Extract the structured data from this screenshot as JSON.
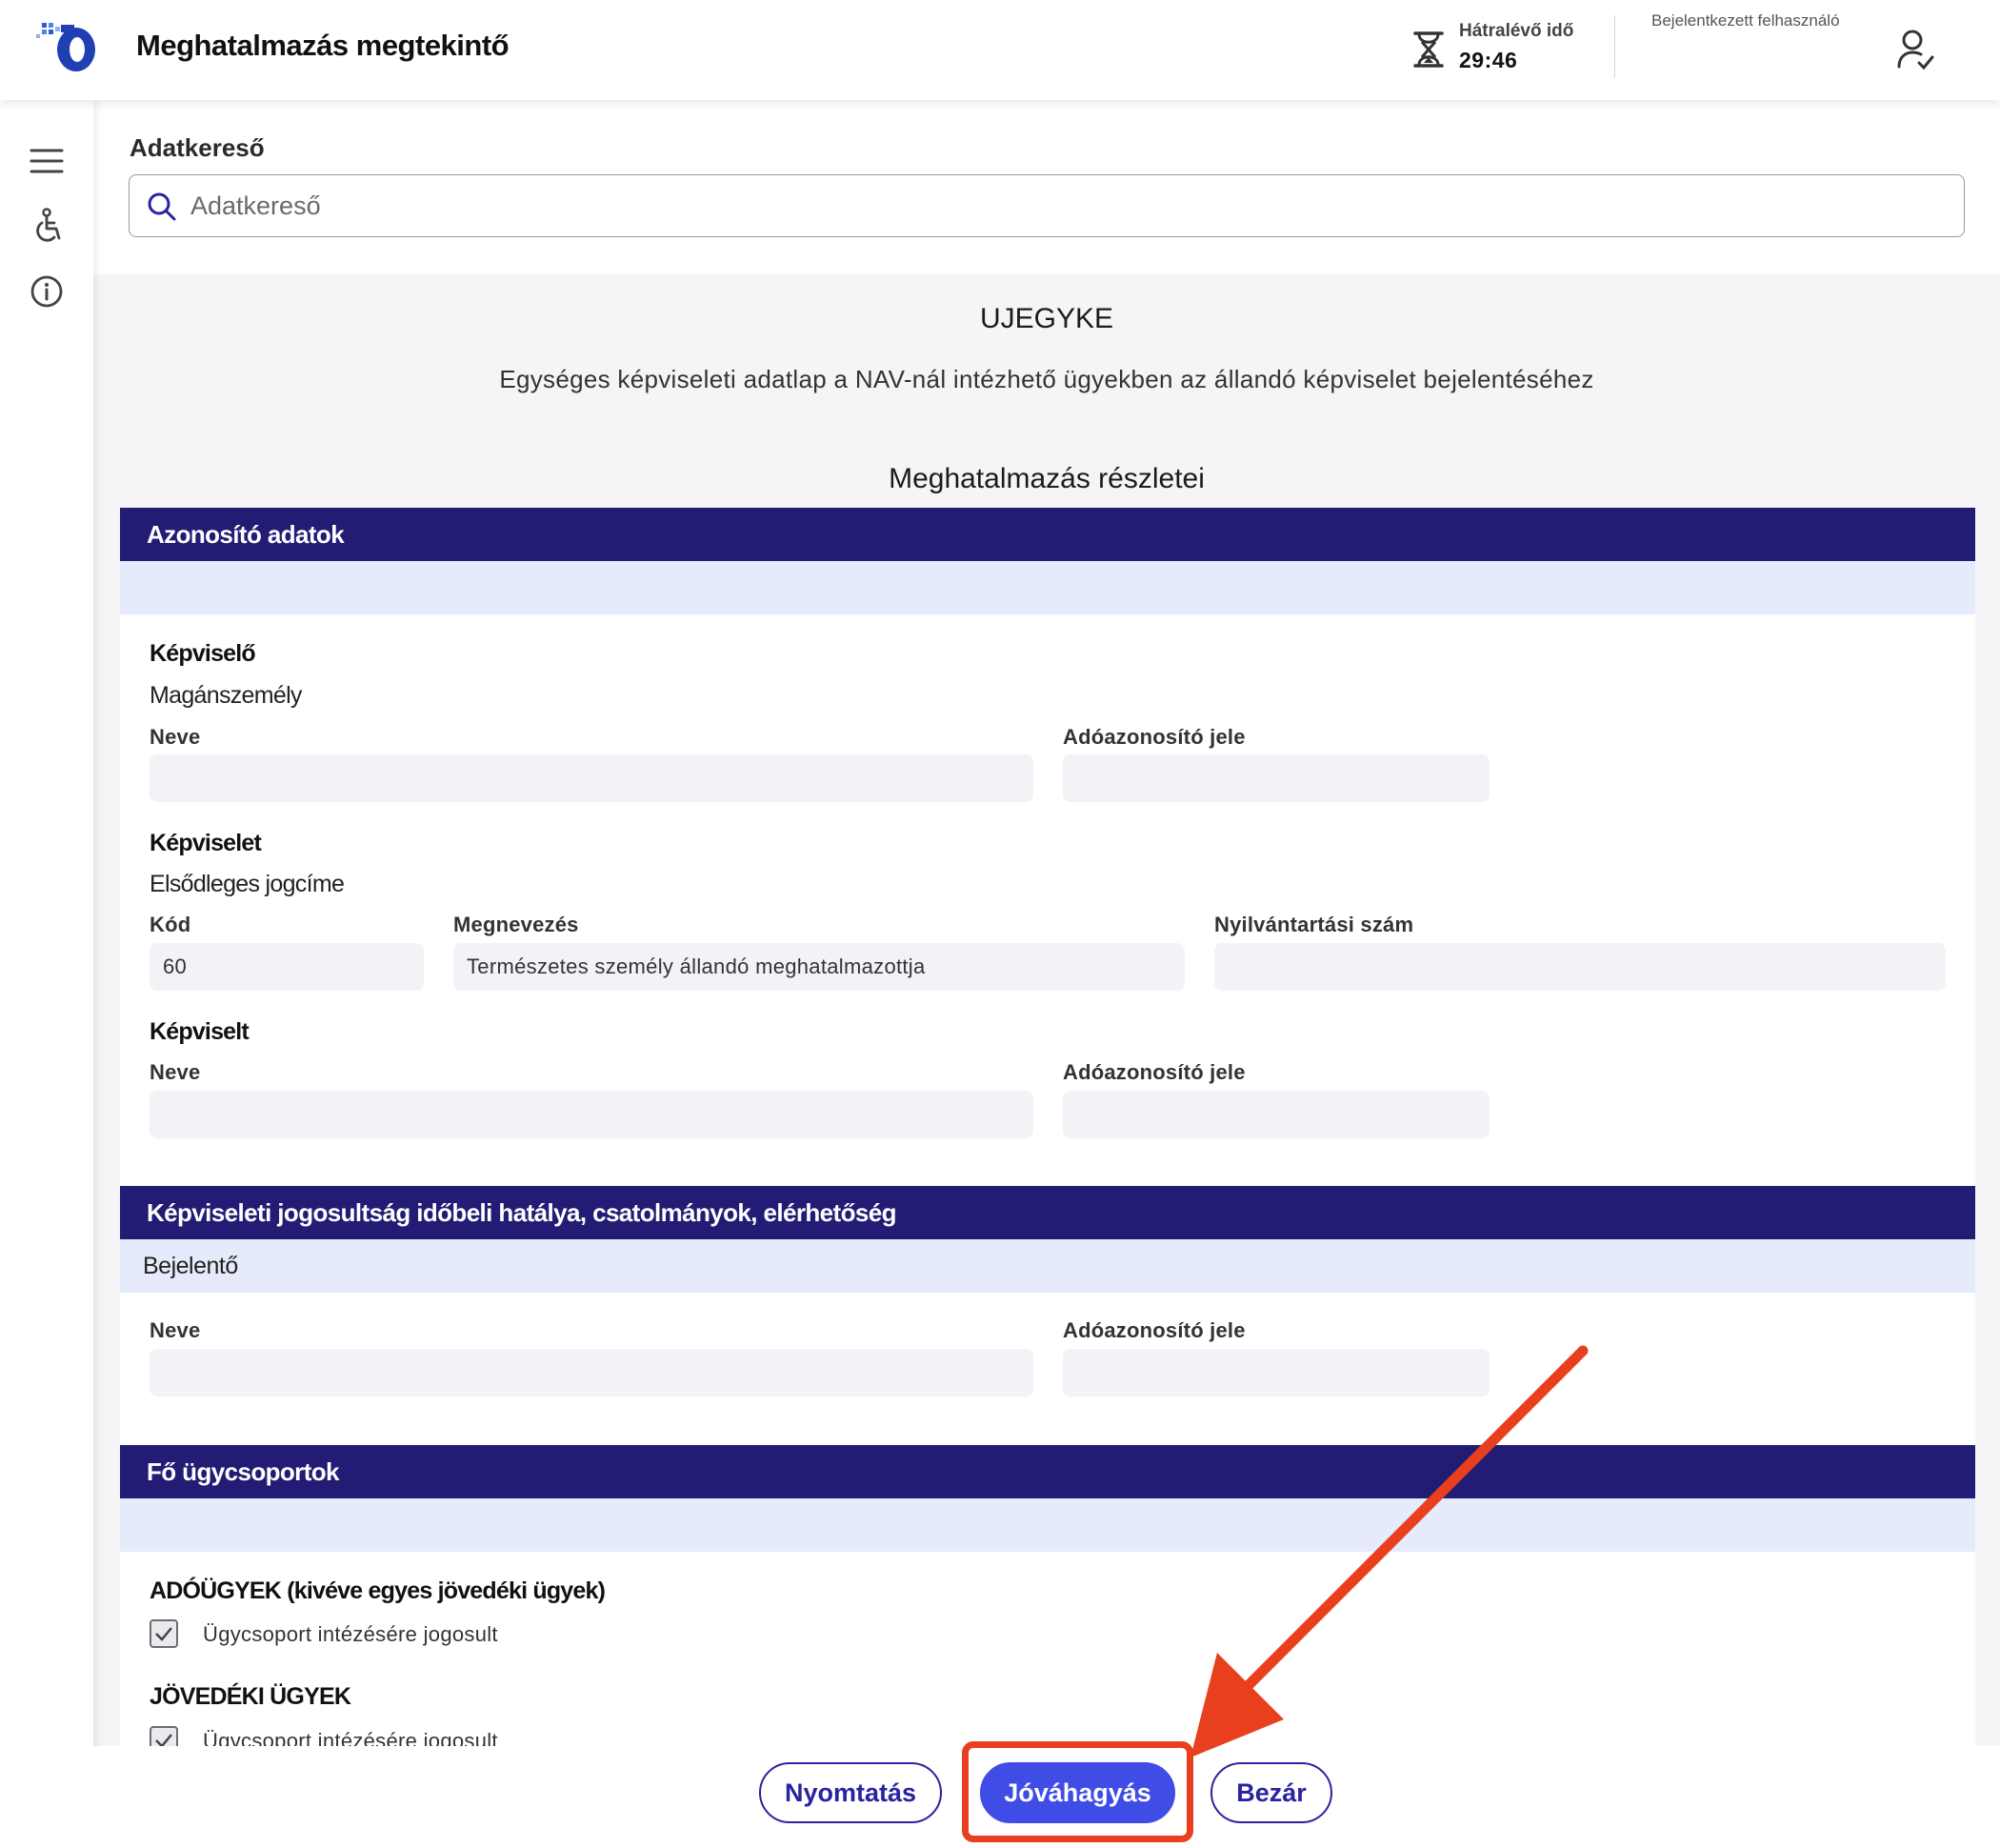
{
  "header": {
    "app_title": "Meghatalmazás megtekintő",
    "timer_label": "Hátralévő idő",
    "timer_value": "29:46",
    "user_label": "Bejelentkezett felhasználó",
    "icons": [
      "logo-icon",
      "hourglass-icon",
      "user-check-icon"
    ]
  },
  "rail": {
    "icons": [
      "menu-icon",
      "accessibility-icon",
      "info-icon"
    ]
  },
  "search": {
    "label": "Adatkereső",
    "placeholder": "Adatkereső"
  },
  "document": {
    "code": "UJEGYKE",
    "description": "Egységes képviseleti adatlap a NAV-nál intézhető ügyekben az állandó képviselet bejelentéséhez",
    "details_title": "Meghatalmazás részletei"
  },
  "section_identity": {
    "header": "Azonosító adatok",
    "representative": {
      "heading": "Képviselő",
      "type": "Magánszemély",
      "name_label": "Neve",
      "name_value": "",
      "tax_id_label": "Adóazonosító jele",
      "tax_id_value": ""
    },
    "representation": {
      "heading": "Képviselet",
      "subheading": "Elsődleges jogcíme",
      "code_label": "Kód",
      "code_value": "60",
      "name_label": "Megnevezés",
      "name_value": "Természetes személy állandó meghatalmazottja",
      "reg_label": "Nyilvántartási szám",
      "reg_value": ""
    },
    "represented": {
      "heading": "Képviselt",
      "name_label": "Neve",
      "name_value": "",
      "tax_id_label": "Adóazonosító jele",
      "tax_id_value": ""
    }
  },
  "section_validity": {
    "header": "Képviseleti jogosultság időbeli hatálya, csatolmányok, elérhetőség",
    "subheader": "Bejelentő",
    "name_label": "Neve",
    "name_value": "",
    "tax_id_label": "Adóazonosító jele",
    "tax_id_value": ""
  },
  "section_groups": {
    "header": "Fő ügycsoportok",
    "groups": [
      {
        "title": "ADÓÜGYEK (kivéve egyes jövedéki ügyek)",
        "checkbox_label": "Ügycsoport intézésére jogosult",
        "checked": true
      },
      {
        "title": "JÖVEDÉKI ÜGYEK",
        "checkbox_label": "Ügycsoport intézésére jogosult",
        "checked": true
      }
    ]
  },
  "actions": {
    "print": "Nyomtatás",
    "approve": "Jóváhagyás",
    "close": "Bezár"
  },
  "colors": {
    "section_header": "#221c74",
    "section_sub": "#e5ebfa",
    "primary_button": "#3f4de6",
    "annotation": "#e8401f"
  }
}
